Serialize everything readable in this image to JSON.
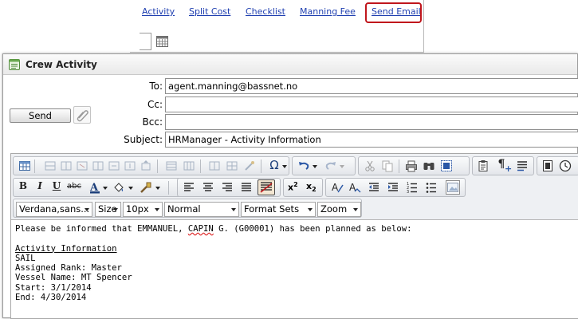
{
  "background_page": {
    "tabs": [
      "Activity",
      "Split Cost",
      "Checklist",
      "Manning Fee",
      "Send Email"
    ],
    "highlighted_tab": "Send Email",
    "highlight_color": "#c0161c",
    "link_color": "#1f3fb0"
  },
  "dialog": {
    "title": "Crew Activity",
    "send_label": "Send",
    "fields": {
      "to_label": "To:",
      "to_value": "agent.manning@bassnet.no",
      "cc_label": "Cc:",
      "cc_value": "",
      "bcc_label": "Bcc:",
      "bcc_value": "",
      "subject_label": "Subject:",
      "subject_value": "HRManager - Activity Information"
    },
    "editor": {
      "format_buttons": [
        "B",
        "I",
        "U",
        "abc"
      ],
      "font_select": "Verdana,sans...",
      "size_select": "Size",
      "px_select": "10px",
      "style_select": "Normal",
      "format_sets_select": "Format Sets",
      "zoom_select": "Zoom",
      "body": {
        "intro_pre": "Please be informed that EMMANUEL, ",
        "intro_misspelled": "CAPIN",
        "intro_post": " G. (G00001) has been planned as below:",
        "heading": "Activity Information",
        "lines": [
          "SAIL",
          "Assigned Rank: Master",
          "Vessel Name: MT Spencer",
          "Start: 3/1/2014",
          "End: 4/30/2014"
        ]
      }
    }
  },
  "icons": [
    "calendar-icon",
    "email-form-icon",
    "paperclip-icon",
    "table-icon",
    "omega-icon",
    "undo-icon",
    "redo-icon",
    "cut-icon",
    "copy-icon",
    "print-icon",
    "find-icon",
    "select-all-icon",
    "paste-icon",
    "paragraph-icon",
    "justify-icon",
    "page-icon",
    "clock-icon",
    "font-color-icon",
    "highlight-icon",
    "paint-icon",
    "align-left-icon",
    "align-center-icon",
    "align-right-icon",
    "align-justify-icon",
    "border-icon",
    "superscript-icon",
    "subscript-icon",
    "clear-format-icon",
    "spell-icon",
    "outdent-icon",
    "indent-icon",
    "numbered-list-icon",
    "bullet-list-icon",
    "image-icon"
  ]
}
